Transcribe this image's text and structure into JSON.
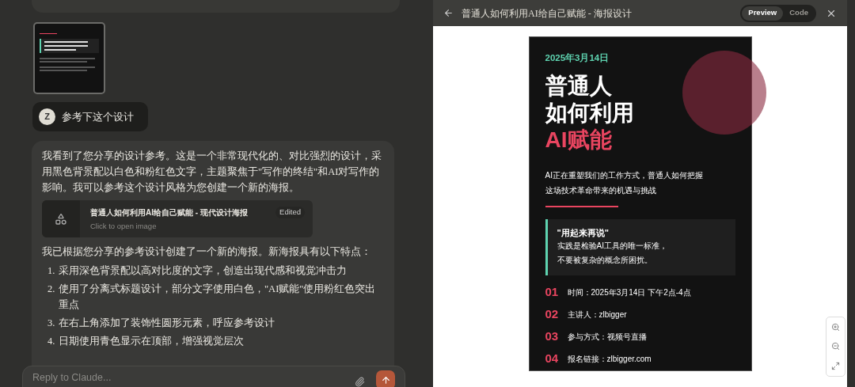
{
  "chat": {
    "user_message": {
      "avatar": "Z",
      "text": "参考下这个设计"
    },
    "reply": {
      "intro": "我看到了您分享的设计参考。这是一个非常现代化的、对比强烈的设计，采用黑色背景配以白色和粉红色文字，主题聚焦于\"写作的终结\"和AI对写作的影响。我可以参考这个设计风格为您创建一个新的海报。",
      "artifact": {
        "title": "普通人如何利用AI给自己赋能 - 现代设计海报",
        "subtitle": "Click to open image",
        "badge": "Edited"
      },
      "lead": "我已根据您分享的参考设计创建了一个新的海报。新海报具有以下特点：",
      "list": [
        {
          "number": "1.",
          "text": "采用深色背景配以高对比度的文字，创造出现代感和视觉冲击力"
        },
        {
          "number": "2.",
          "text": "使用了分离式标题设计，部分文字使用白色，\"AI赋能\"使用粉红色突出重点"
        },
        {
          "number": "3.",
          "text": "在右上角添加了装饰性圆形元素，呼应参考设计"
        },
        {
          "number": "4.",
          "text": "日期使用青色显示在顶部，增强视觉层次"
        }
      ]
    },
    "input": {
      "placeholder": "Reply to Claude..."
    }
  },
  "preview": {
    "title": "普通人如何利用AI给自己赋能 - 海报设计",
    "tabs": [
      {
        "label": "Preview",
        "selected": true
      },
      {
        "label": "Code",
        "selected": false
      }
    ],
    "poster": {
      "date": "2025年3月14日",
      "title_lines": [
        "普通人",
        "如何利用"
      ],
      "highlight": "AI赋能",
      "subtitle_lines": [
        "AI正在重塑我们的工作方式，普通人如何把握",
        "这场技术革命带来的机遇与挑战"
      ],
      "quote": {
        "title": "\"用起来再说\"",
        "lines": [
          "实践是检验AI工具的唯一标准，",
          "不要被复杂的概念所困扰。"
        ]
      },
      "items": [
        {
          "number": "01",
          "text": "时间：2025年3月14日 下午2点-4点"
        },
        {
          "number": "02",
          "text": "主讲人：zlbigger"
        },
        {
          "number": "03",
          "text": "参与方式：视频号直播"
        },
        {
          "number": "04",
          "text": "报名链接：zlbigger.com"
        }
      ]
    }
  }
}
